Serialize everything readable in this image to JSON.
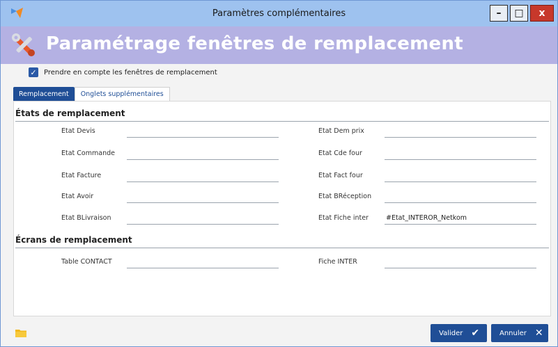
{
  "window": {
    "title": "Paramètres complémentaires",
    "controls": {
      "minimize": "–",
      "maximize": "□",
      "close": "x"
    }
  },
  "banner": {
    "title": "Paramétrage fenêtres de remplacement"
  },
  "checkbox": {
    "label": "Prendre en compte les fenêtres de remplacement",
    "checked": true
  },
  "tabs": [
    {
      "label": "Remplacement",
      "active": true
    },
    {
      "label": "Onglets supplémentaires",
      "active": false
    }
  ],
  "sections": {
    "etats": {
      "title": "États de remplacement",
      "left": [
        {
          "label": "Etat Devis",
          "value": ""
        },
        {
          "label": "Etat Commande",
          "value": ""
        },
        {
          "label": "Etat Facture",
          "value": ""
        },
        {
          "label": "Etat Avoir",
          "value": ""
        },
        {
          "label": "Etat BLivraison",
          "value": ""
        }
      ],
      "right": [
        {
          "label": "Etat Dem prix",
          "value": ""
        },
        {
          "label": "Etat Cde four",
          "value": ""
        },
        {
          "label": "Etat Fact four",
          "value": ""
        },
        {
          "label": "Etat BRéception",
          "value": ""
        },
        {
          "label": "Etat Fiche inter",
          "value": "#Etat_INTEROR_Netkom"
        }
      ]
    },
    "ecrans": {
      "title": "Écrans de remplacement",
      "left": [
        {
          "label": "Table CONTACT",
          "value": ""
        }
      ],
      "right": [
        {
          "label": "Fiche INTER",
          "value": ""
        }
      ]
    }
  },
  "footer": {
    "validate_label": "Valider",
    "validate_icon": "✔",
    "cancel_label": "Annuler",
    "cancel_icon": "✕"
  },
  "colors": {
    "titlebar": "#9ec2ef",
    "banner": "#b4b1e3",
    "accent": "#1f4e96",
    "close": "#c7382b"
  }
}
